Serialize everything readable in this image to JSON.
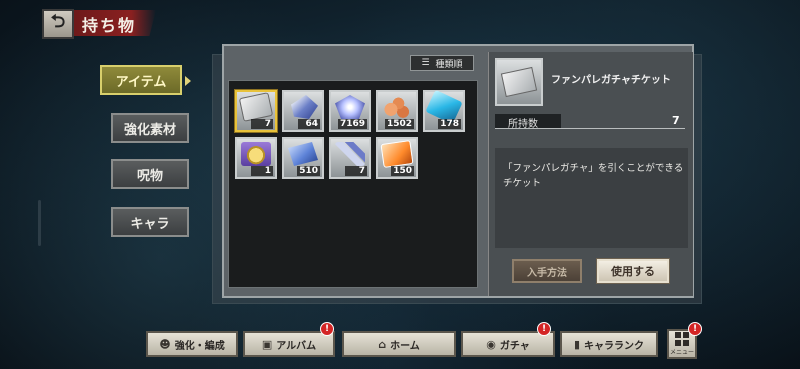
{
  "header": {
    "title": "持ち物",
    "back_icon": "back-arrow-icon"
  },
  "categories": [
    {
      "label": "アイテム",
      "active": true
    },
    {
      "label": "強化素材",
      "active": false
    },
    {
      "label": "呪物",
      "active": false
    },
    {
      "label": "キャラ",
      "active": false
    }
  ],
  "sort": {
    "label": "種類順",
    "icon": "list-sort-icon"
  },
  "items": [
    {
      "icon": "ticket-icon",
      "qty": "7",
      "selected": true
    },
    {
      "icon": "blue-shards-icon",
      "qty": "64"
    },
    {
      "icon": "crystal-icon",
      "qty": "7169"
    },
    {
      "icon": "orange-leaves-icon",
      "qty": "1502"
    },
    {
      "icon": "blue-bottle-icon",
      "qty": "178"
    },
    {
      "icon": "gold-medal-icon",
      "qty": "1"
    },
    {
      "icon": "blue-sheet-icon",
      "qty": "510"
    },
    {
      "icon": "sword-icon",
      "qty": "7"
    },
    {
      "icon": "orange-ticket-icon",
      "qty": "150"
    }
  ],
  "detail": {
    "name": "ファンパレガチャチケット",
    "owned_label": "所持数",
    "owned_value": "7",
    "description": "「ファンパレガチャ」を引くことができるチケット",
    "how_to_get_label": "入手方法",
    "use_label": "使用する"
  },
  "nav": [
    {
      "label": "強化・編成",
      "icon": "people-icon",
      "badge": false
    },
    {
      "label": "アルバム",
      "icon": "album-icon",
      "badge": true
    },
    {
      "label": "ホーム",
      "icon": "home-icon",
      "badge": false
    },
    {
      "label": "ガチャ",
      "icon": "gacha-icon",
      "badge": true
    },
    {
      "label": "キャラランク",
      "icon": "character-rank-icon",
      "badge": false
    }
  ],
  "menu": {
    "label": "メニュー",
    "badge": true,
    "badge_text": "!"
  },
  "badge_text": "!"
}
